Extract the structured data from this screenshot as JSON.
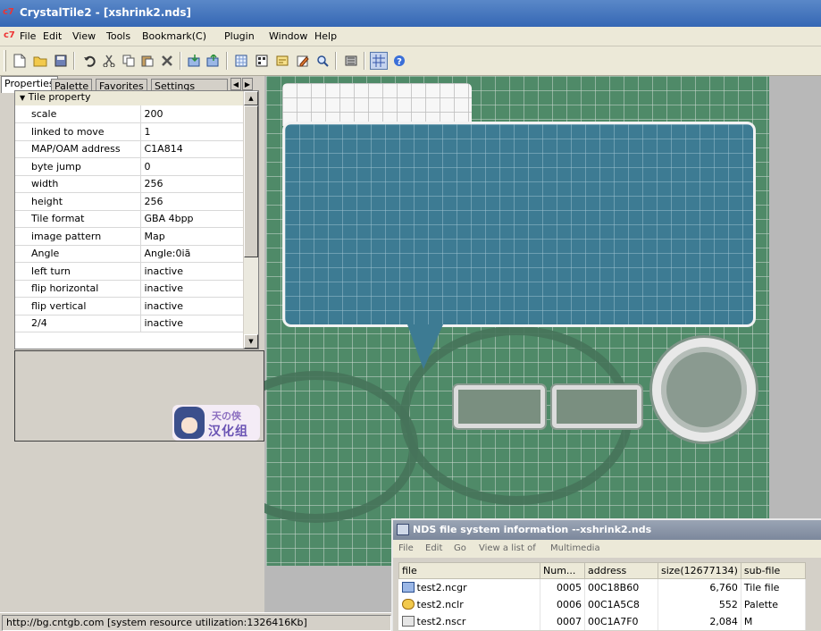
{
  "window": {
    "title": "CrystalTile2 - [xshrink2.nds]",
    "app_icon": "crystaltile-logo-icon"
  },
  "menubar": {
    "items": [
      "File",
      "Edit",
      "View",
      "Tools",
      "Bookmark(C)",
      "Plugin",
      "Window",
      "Help"
    ]
  },
  "toolbar": {
    "buttons": [
      "new-file-icon",
      "open-folder-icon",
      "save-icon",
      "undo-icon",
      "cut-icon",
      "copy-icon",
      "paste-icon",
      "delete-icon",
      "import-icon",
      "export-icon",
      "tile-view-icon",
      "palette-view-icon",
      "map-view-icon",
      "edit-icon",
      "search-icon",
      "memory-icon",
      "grid-icon",
      "help-icon"
    ]
  },
  "panel_tabs": {
    "tabs": [
      "Properties",
      "Palette",
      "Favorites",
      "Settings"
    ],
    "active": "Properties"
  },
  "properties": {
    "header": "Tile property",
    "rows": [
      {
        "key": "scale",
        "value": "200"
      },
      {
        "key": "linked to move",
        "value": "1"
      },
      {
        "key": "MAP/OAM address",
        "value": "C1A814"
      },
      {
        "key": "byte jump",
        "value": "0"
      },
      {
        "key": "width",
        "value": "256"
      },
      {
        "key": "height",
        "value": "256"
      },
      {
        "key": "Tile format",
        "value": "GBA 4bpp"
      },
      {
        "key": "image pattern",
        "value": "Map"
      },
      {
        "key": "Angle",
        "value": "Angle:0iã"
      },
      {
        "key": "left turn",
        "value": "inactive"
      },
      {
        "key": "flip horizontal",
        "value": "inactive"
      },
      {
        "key": "flip vertical",
        "value": "inactive"
      },
      {
        "key": "2/4",
        "value": "inactive"
      }
    ]
  },
  "logo": {
    "line1": "天の侠",
    "line2": "汉化组"
  },
  "statusbar": {
    "text": "http://bg.cntgb.com [system resource utilization:1326416Kb]"
  },
  "nds_window": {
    "title": "NDS file system information --xshrink2.nds",
    "menu": [
      "File",
      "Edit",
      "Go",
      "View a list of",
      "Multimedia"
    ],
    "columns": [
      "file",
      "Num...",
      "address",
      "size(12677134)",
      "sub-file"
    ],
    "rows": [
      {
        "icon": "image-file-icon",
        "file": "test2.ncgr",
        "num": "0005",
        "address": "00C18B60",
        "size": "6,760",
        "subfile": "Tile file"
      },
      {
        "icon": "palette-file-icon",
        "file": "test2.nclr",
        "num": "0006",
        "address": "00C1A5C8",
        "size": "552",
        "subfile": "Palette"
      },
      {
        "icon": "map-file-icon",
        "file": "test2.nscr",
        "num": "0007",
        "address": "00C1A7F0",
        "size": "2,084",
        "subfile": "M"
      }
    ]
  }
}
